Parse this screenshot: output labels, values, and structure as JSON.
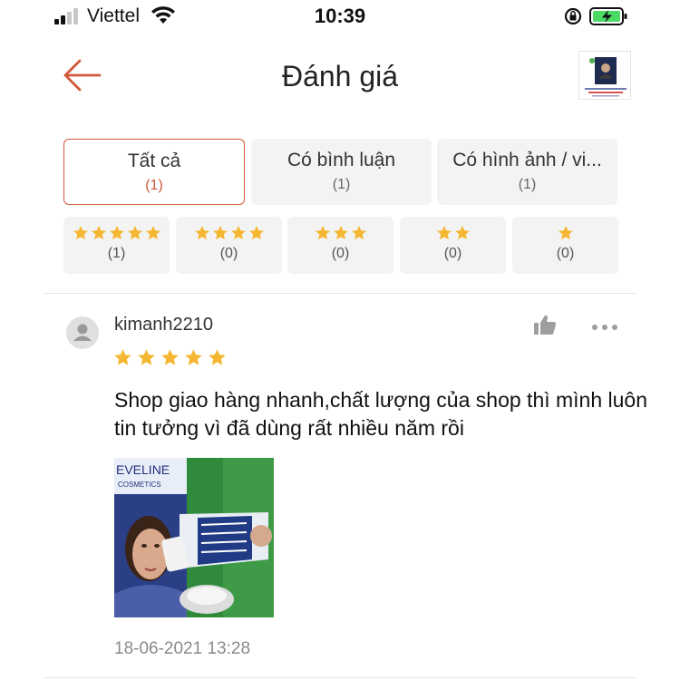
{
  "status_bar": {
    "carrier": "Viettel",
    "time": "10:39"
  },
  "header": {
    "title": "Đánh giá"
  },
  "filters": [
    {
      "label": "Tất cả",
      "count": "(1)",
      "active": true
    },
    {
      "label": "Có bình luận",
      "count": "(1)",
      "active": false
    },
    {
      "label": "Có hình ảnh / vi...",
      "count": "(1)",
      "active": false
    }
  ],
  "star_filters": [
    {
      "stars": 5,
      "count": "(1)"
    },
    {
      "stars": 4,
      "count": "(0)"
    },
    {
      "stars": 3,
      "count": "(0)"
    },
    {
      "stars": 2,
      "count": "(0)"
    },
    {
      "stars": 1,
      "count": "(0)"
    }
  ],
  "review": {
    "username": "kimanh2210",
    "rating": 5,
    "text": "Shop giao hàng nhanh,chất lượng của shop thì mình luôn tin tưởng vì đã dùng rất nhiều năm rồi",
    "date": "18-06-2021 13:28",
    "photo_brand_text": "EVELINE",
    "photo_sub_text": "COSMETICS"
  },
  "colors": {
    "accent": "#d0593a",
    "star": "#f5b731",
    "photo_bg": "#2f8a3c"
  },
  "icons": {
    "back": "arrow-left-icon",
    "like": "thumbs-up-icon",
    "more": "more-dots-icon"
  }
}
